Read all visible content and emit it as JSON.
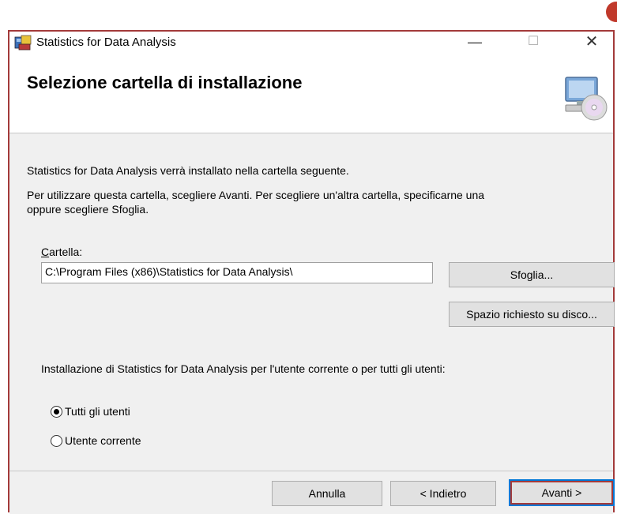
{
  "window": {
    "title": "Statistics for Data Analysis",
    "minimize": "—",
    "maximize": "☐",
    "close": "✕"
  },
  "header": {
    "title": "Selezione cartella di installazione"
  },
  "content": {
    "line1": "Statistics for Data Analysis verrà installato nella cartella seguente.",
    "line2a": "Per utilizzare questa cartella, scegliere Avanti. Per scegliere un'altra cartella, specificarne una",
    "line2b": "oppure scegliere Sfoglia.",
    "folder_label_u": "C",
    "folder_label_rest": "artella:",
    "folder_value": "C:\\Program Files (x86)\\Statistics for Data Analysis\\",
    "browse_button": "Sfoglia...",
    "disk_button": "Spazio richiesto su disco...",
    "install_for": "Installazione di Statistics for Data Analysis per l'utente corrente o per tutti gli utenti:",
    "radio_all": "Tutti gli utenti",
    "radio_current": "Utente corrente",
    "radio_selected": "all"
  },
  "footer": {
    "cancel": "Annulla",
    "back": "< Indietro",
    "next": "Avanti >"
  },
  "colors": {
    "highlight": "#a33a3a",
    "focus": "#0078d7"
  }
}
